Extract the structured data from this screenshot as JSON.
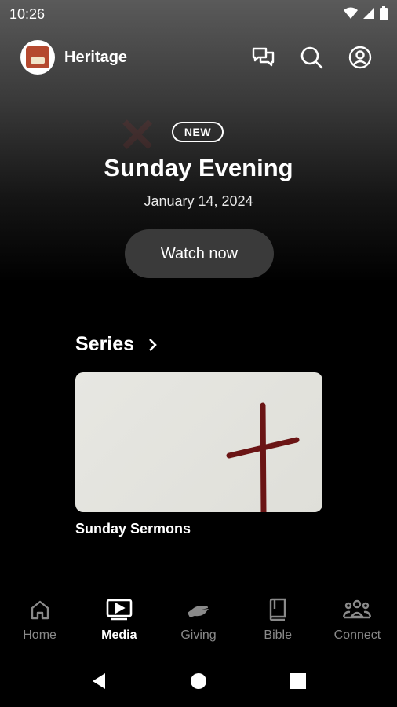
{
  "status_bar": {
    "time": "10:26"
  },
  "app": {
    "name": "Heritage"
  },
  "hero": {
    "badge": "NEW",
    "title": "Sunday Evening",
    "date": "January 14, 2024",
    "cta_label": "Watch now"
  },
  "series": {
    "title": "Series",
    "items": [
      {
        "label": "Sunday Sermons"
      }
    ]
  },
  "nav": {
    "items": [
      {
        "label": "Home",
        "icon": "home-icon",
        "active": false
      },
      {
        "label": "Media",
        "icon": "play-screen-icon",
        "active": true
      },
      {
        "label": "Giving",
        "icon": "giving-hand-icon",
        "active": false
      },
      {
        "label": "Bible",
        "icon": "book-icon",
        "active": false
      },
      {
        "label": "Connect",
        "icon": "people-icon",
        "active": false
      }
    ]
  },
  "colors": {
    "background": "#000000",
    "button": "#3a3a3a",
    "inactive": "#8a8a8a",
    "cross": "#6b1515"
  }
}
